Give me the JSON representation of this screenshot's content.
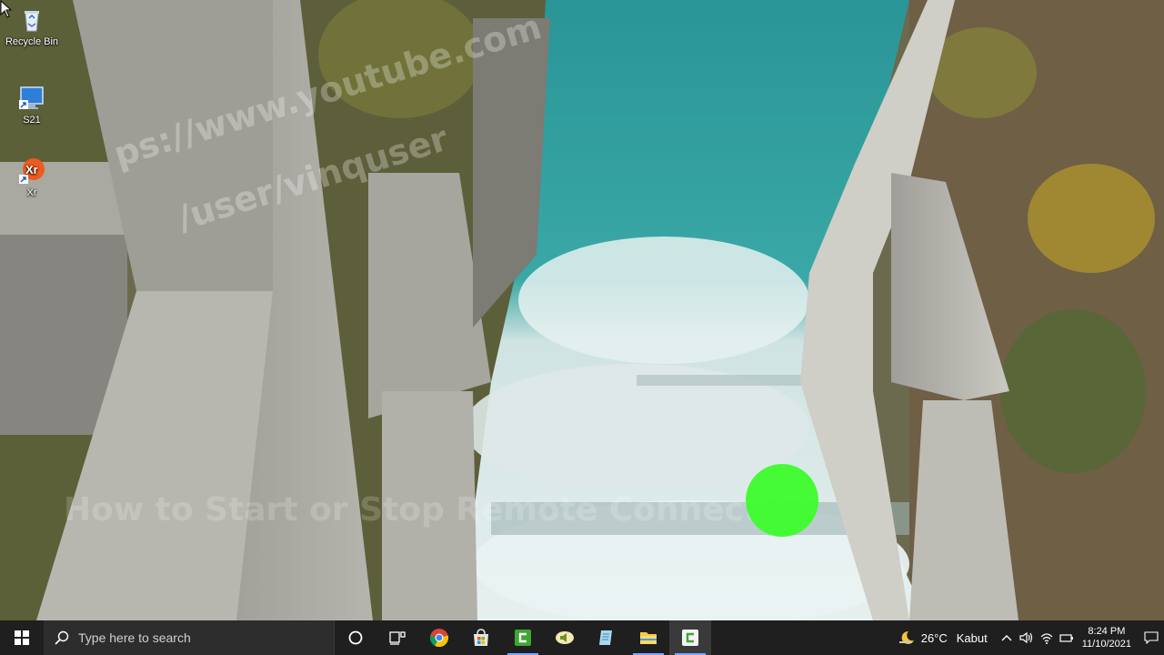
{
  "desktop": {
    "icons": [
      {
        "label": "Recycle Bin",
        "icon": "recycle-bin-icon"
      },
      {
        "label": "S21",
        "icon": "monitor-shortcut-icon"
      },
      {
        "label": "Xr",
        "icon": "xr-app-icon"
      }
    ],
    "watermark": {
      "line1": "ps://www.youtube.com",
      "line2": "/user/vinquser",
      "line3": "How to Start or Stop Remote Connection"
    }
  },
  "taskbar": {
    "search_placeholder": "Type here to search",
    "apps": [
      {
        "name": "task-view",
        "icon": "cortana-circle-icon"
      },
      {
        "name": "task-view-2",
        "icon": "task-view-icon"
      },
      {
        "name": "chrome",
        "icon": "chrome-icon"
      },
      {
        "name": "store",
        "icon": "store-icon"
      },
      {
        "name": "camtasia",
        "icon": "camtasia-green-icon"
      },
      {
        "name": "audio",
        "icon": "speaker-app-icon"
      },
      {
        "name": "notepad",
        "icon": "notepad-icon"
      },
      {
        "name": "explorer",
        "icon": "folder-icon"
      },
      {
        "name": "camtasia-recorder",
        "icon": "camtasia-white-icon"
      }
    ],
    "weather": {
      "temperature": "26°C",
      "condition": "Kabut"
    },
    "clock": {
      "time": "8:24 PM",
      "date": "11/10/2021"
    }
  },
  "colors": {
    "taskbar_bg": "#1f1f1f",
    "click_highlight": "#3dfc2c",
    "water": "#2f9a9c"
  }
}
